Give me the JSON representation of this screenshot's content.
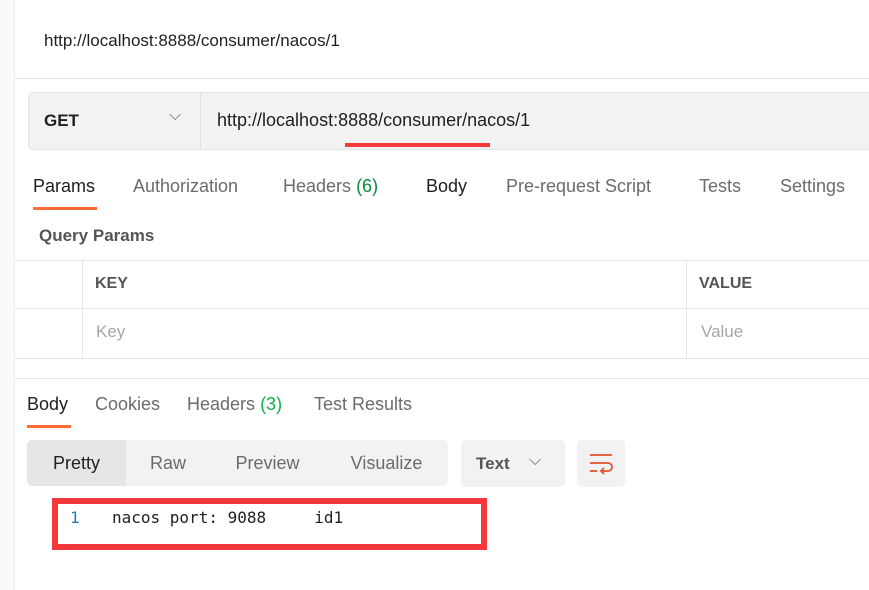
{
  "request_title": "http://localhost:8888/consumer/nacos/1",
  "url_bar": {
    "method": "GET",
    "url": "http://localhost:8888/consumer/nacos/1"
  },
  "request_tabs": [
    {
      "label": "Params",
      "active": true
    },
    {
      "label": "Authorization"
    },
    {
      "label": "Headers",
      "count": "(6)"
    },
    {
      "label": "Body"
    },
    {
      "label": "Pre-request Script"
    },
    {
      "label": "Tests"
    },
    {
      "label": "Settings"
    }
  ],
  "query_params": {
    "title": "Query Params",
    "columns": [
      "KEY",
      "VALUE"
    ],
    "placeholders": [
      "Key",
      "Value"
    ]
  },
  "response_tabs": [
    {
      "label": "Body",
      "active": true
    },
    {
      "label": "Cookies"
    },
    {
      "label": "Headers",
      "count": "(3)"
    },
    {
      "label": "Test Results"
    }
  ],
  "view_modes": [
    "Pretty",
    "Raw",
    "Preview",
    "Visualize"
  ],
  "active_view": "Pretty",
  "format": "Text",
  "response_body": [
    {
      "line": "1",
      "text": "nacos port: 9088     id1"
    }
  ],
  "colors": {
    "accent": "#ff6c37",
    "annotation": "#f5383a",
    "count": "#0a8a3c"
  }
}
